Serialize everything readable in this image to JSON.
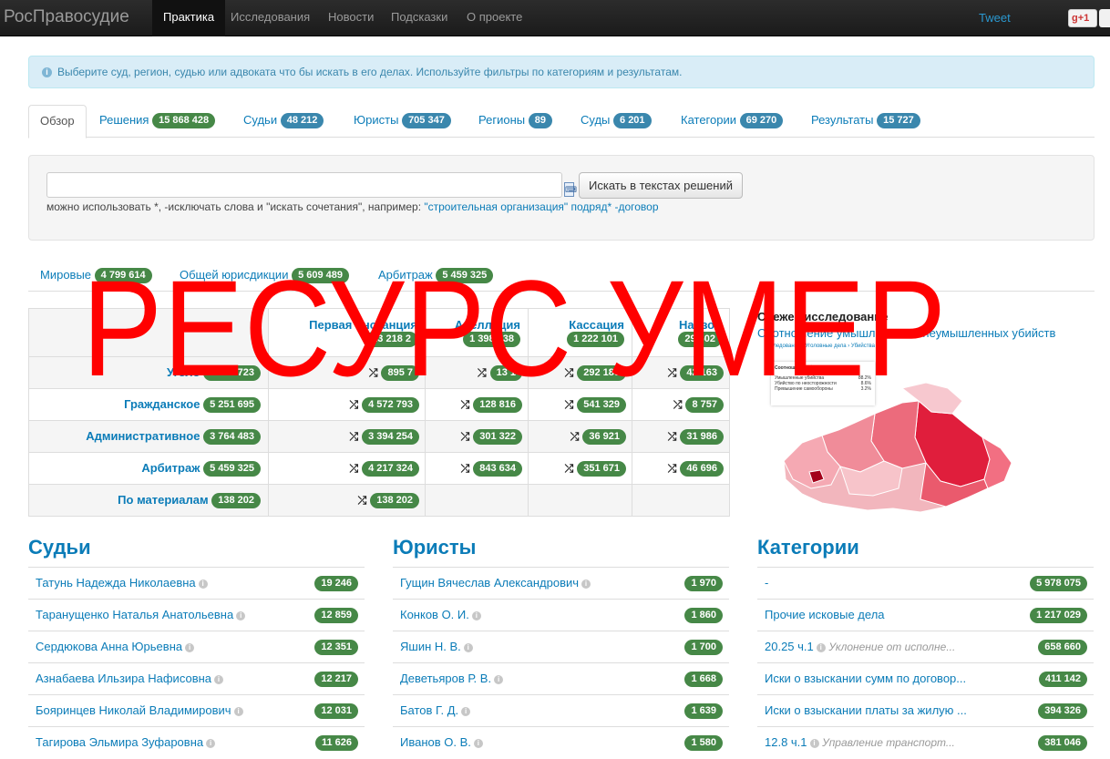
{
  "navbar": {
    "brand": "РосПравосудие",
    "items": [
      "Практика",
      "Исследования",
      "Новости",
      "Подсказки",
      "О проекте"
    ],
    "active_index": 0,
    "tweet": "Tweet",
    "gplus": "+1"
  },
  "alert": {
    "text": "Выберите суд, регион, судью или адвоката что бы искать в его делах. Используйте фильтры по категориям и результатам."
  },
  "tabs": [
    {
      "label": "Обзор",
      "count": null
    },
    {
      "label": "Решения",
      "count": "15 868 428",
      "color": "green"
    },
    {
      "label": "Судьи",
      "count": "48 212",
      "color": "blue"
    },
    {
      "label": "Юристы",
      "count": "705 347",
      "color": "blue"
    },
    {
      "label": "Регионы",
      "count": "89",
      "color": "blue"
    },
    {
      "label": "Суды",
      "count": "6 201",
      "color": "blue"
    },
    {
      "label": "Категории",
      "count": "69 270",
      "color": "blue"
    },
    {
      "label": "Результаты",
      "count": "15 727",
      "color": "blue"
    }
  ],
  "search": {
    "value": "",
    "button": "Искать в текстах решений",
    "hint_prefix": "можно использовать *, -исключать слова и \"искать сочетания\", например: ",
    "hint_example": "\"строительная организация\" подряд* -договор"
  },
  "courts": [
    {
      "label": "Мировые",
      "count": "4 799 614"
    },
    {
      "label": "Общей юрисдикции",
      "count": "5 609 489"
    },
    {
      "label": "Арбитраж",
      "count": "5 459 325"
    }
  ],
  "practice": {
    "columns": [
      {
        "label": "Первая инстанция",
        "count": "13 218 2"
      },
      {
        "label": "Апелляция",
        "count": "1 398 438"
      },
      {
        "label": "Кассация",
        "count": "1 222 101"
      },
      {
        "label": "Надзор",
        "count": "29 602"
      }
    ],
    "rows": [
      {
        "label": "Уголо",
        "count": "1 024 723",
        "cells": [
          "895 7",
          "13 1",
          "292 180",
          "42 163"
        ]
      },
      {
        "label": "Гражданское",
        "count": "5 251 695",
        "cells": [
          "4 572 793",
          "128 816",
          "541 329",
          "8 757"
        ]
      },
      {
        "label": "Административное",
        "count": "3 764 483",
        "cells": [
          "3 394 254",
          "301 322",
          "36 921",
          "31 986"
        ]
      },
      {
        "label": "Арбитраж",
        "count": "5 459 325",
        "cells": [
          "4 217 324",
          "843 634",
          "351 671",
          "46 696"
        ]
      },
      {
        "label": "По материалам",
        "count": "138 202",
        "cells": [
          "138 202",
          "",
          "",
          ""
        ]
      }
    ]
  },
  "research": {
    "title": "Свежее исследование",
    "link": "Соотношение умышленных и неумышленных убийств",
    "crumbs": "Исследования › Уголовные дела › Убийства",
    "card_title": "Соотношение убийств",
    "card_rows": [
      {
        "label": "Умышленные убийства",
        "value": "88.2%"
      },
      {
        "label": "Убийство по неосторожности",
        "value": "8.6%"
      },
      {
        "label": "Превышение самообороны",
        "value": "3.2%"
      }
    ]
  },
  "judges": {
    "title": "Судьи",
    "items": [
      {
        "name": "Татунь Надежда Николаевна",
        "count": "19 246"
      },
      {
        "name": "Таранущенко Наталья Анатольевна",
        "count": "12 859"
      },
      {
        "name": "Сердюкова Анна Юрьевна",
        "count": "12 351"
      },
      {
        "name": "Азнабаева Ильзира Нафисовна",
        "count": "12 217"
      },
      {
        "name": "Бояринцев Николай Владимирович",
        "count": "12 031"
      },
      {
        "name": "Тагирова Эльмира Зуфаровна",
        "count": "11 626"
      }
    ]
  },
  "lawyers": {
    "title": "Юристы",
    "items": [
      {
        "name": "Гущин Вячеслав Александрович",
        "count": "1 970"
      },
      {
        "name": "Конков О. И.",
        "count": "1 860"
      },
      {
        "name": "Яшин Н. В.",
        "count": "1 700"
      },
      {
        "name": "Деветьяров Р. В.",
        "count": "1 668"
      },
      {
        "name": "Батов Г. Д.",
        "count": "1 639"
      },
      {
        "name": "Иванов О. В.",
        "count": "1 580"
      }
    ]
  },
  "categories": {
    "title": "Категории",
    "items": [
      {
        "name": "-",
        "sub": "",
        "count": "5 978 075"
      },
      {
        "name": "Прочие исковые дела",
        "sub": "",
        "count": "1 217 029"
      },
      {
        "name": "20.25 ч.1",
        "sub": "Уклонение от исполне...",
        "count": "658 660"
      },
      {
        "name": "Иски о взыскании сумм по договор...",
        "sub": "",
        "count": "411 142"
      },
      {
        "name": "Иски о взыскании платы за жилую ...",
        "sub": "",
        "count": "394 326"
      },
      {
        "name": "12.8 ч.1",
        "sub": "Управление транспорт...",
        "count": "381 046"
      }
    ]
  },
  "overlay": {
    "text": "РЕСУРС УМЕР"
  },
  "colors": {
    "badge_green": "#468847",
    "badge_blue": "#3a87ad",
    "link": "#0b7cb8",
    "overlay": "#ff0000"
  }
}
